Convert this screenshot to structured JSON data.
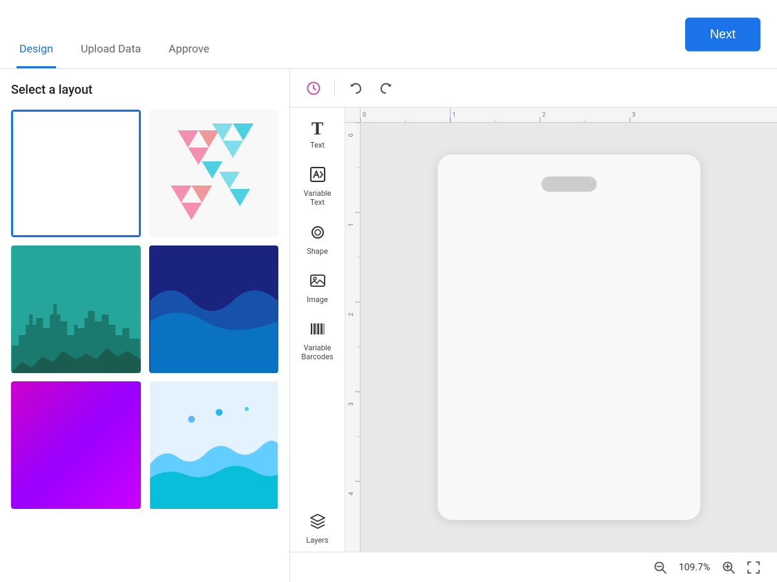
{
  "header": {
    "tabs": [
      {
        "id": "design",
        "label": "Design",
        "active": true
      },
      {
        "id": "upload-data",
        "label": "Upload Data",
        "active": false
      },
      {
        "id": "approve",
        "label": "Approve",
        "active": false
      }
    ],
    "next_button": "Next"
  },
  "left_panel": {
    "title": "Select a layout",
    "layouts": [
      {
        "id": "blank",
        "label": "Blank",
        "selected": true
      },
      {
        "id": "triangles1",
        "label": "Triangles 1",
        "selected": false
      },
      {
        "id": "teal-city",
        "label": "Teal City",
        "selected": false
      },
      {
        "id": "navy-wave",
        "label": "Navy Wave",
        "selected": false
      },
      {
        "id": "purple",
        "label": "Purple",
        "selected": false
      },
      {
        "id": "blue-wave",
        "label": "Blue Wave",
        "selected": false
      }
    ]
  },
  "tools": [
    {
      "id": "text",
      "label": "Text",
      "icon": "T"
    },
    {
      "id": "variable-text",
      "label": "Variable\nText",
      "icon": "✓"
    },
    {
      "id": "shape",
      "label": "Shape",
      "icon": "◯"
    },
    {
      "id": "image",
      "label": "Image",
      "icon": "🖼"
    },
    {
      "id": "variable-barcodes",
      "label": "Variable\nBarcodes",
      "icon": "▦"
    },
    {
      "id": "layers",
      "label": "Layers",
      "icon": "⊞"
    }
  ],
  "toolbar": {
    "history_icon": "↺",
    "undo_icon": "↩",
    "redo_icon": "↪"
  },
  "canvas": {
    "zoom": "109.7%"
  },
  "bottom_bar": {
    "zoom_out_icon": "−",
    "zoom_level": "109.7%",
    "zoom_in_icon": "+",
    "fullscreen_icon": "⛶"
  }
}
